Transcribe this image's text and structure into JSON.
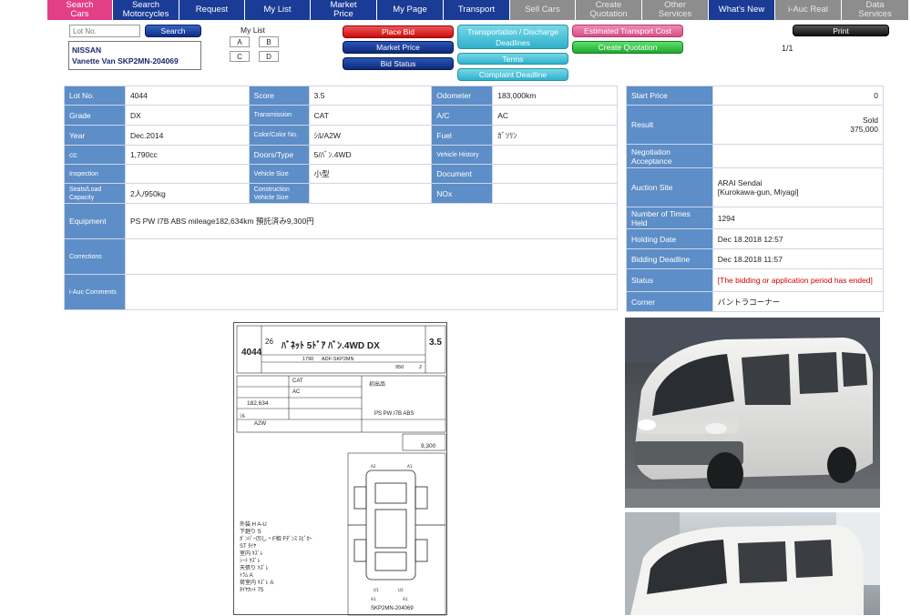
{
  "nav": [
    {
      "label": "Search\nCars",
      "style": "pink"
    },
    {
      "label": "Search\nMotorcycles",
      "style": "blue"
    },
    {
      "label": "Request",
      "style": "blue"
    },
    {
      "label": "My List",
      "style": "blue"
    },
    {
      "label": "Market\nPrice",
      "style": "blue"
    },
    {
      "label": "My Page",
      "style": "blue"
    },
    {
      "label": "Transport",
      "style": "blue"
    },
    {
      "label": "Sell Cars",
      "style": "grey"
    },
    {
      "label": "Create\nQuotation",
      "style": "grey"
    },
    {
      "label": "Other\nServices",
      "style": "grey"
    },
    {
      "label": "What's New",
      "style": "blue"
    },
    {
      "label": "i-Auc Real",
      "style": "grey"
    },
    {
      "label": "Data\nServices",
      "style": "grey"
    }
  ],
  "search": {
    "placeholder": "Lot No.",
    "button": "Search"
  },
  "car": {
    "make": "NISSAN",
    "model": "Vanette Van SKP2MN-204069"
  },
  "mylist": {
    "title": "My List",
    "slots": [
      "A",
      "B",
      "C",
      "D"
    ]
  },
  "actions": {
    "place_bid": "Place Bid",
    "market_price": "Market Price",
    "bid_status": "Bid Status",
    "transportation": "Transportation / Discharge\nDeadlines",
    "terms": "Terms",
    "complaint": "Complaint Deadline",
    "estimated_transport": "Estimated Transport Cost",
    "create_quotation": "Create Quotation",
    "print": "Print"
  },
  "pager": "1/1",
  "specs": {
    "rows": [
      [
        {
          "l": "Lot No.",
          "v": "4044"
        },
        {
          "l": "Score",
          "v": "3.5"
        },
        {
          "l": "Odometer",
          "v": "183,000km"
        }
      ],
      [
        {
          "l": "Grade",
          "v": "DX"
        },
        {
          "l": "Transmission",
          "v": "CAT"
        },
        {
          "l": "A/C",
          "v": "AC"
        }
      ],
      [
        {
          "l": "Year",
          "v": "Dec.2014"
        },
        {
          "l": "Color/Color No.",
          "v": "ｼﾙ/A2W"
        },
        {
          "l": "Fuel",
          "v": "ｶﾞｿﾘﾝ"
        }
      ],
      [
        {
          "l": "cc",
          "v": "1,790cc"
        },
        {
          "l": "Doors/Type",
          "v": "5/ﾊﾞﾝ.4WD"
        },
        {
          "l": "Vehicle History",
          "v": ""
        }
      ],
      [
        {
          "l": "Inspection",
          "v": ""
        },
        {
          "l": "Vehicle Size",
          "v": "小型"
        },
        {
          "l": "Document",
          "v": ""
        }
      ],
      [
        {
          "l": "Seats/Load\nCapacity",
          "v": "2人/950kg"
        },
        {
          "l": "Construction\nVehicle Size",
          "v": ""
        },
        {
          "l": "NOx",
          "v": ""
        }
      ]
    ],
    "equipment": {
      "l": "Equipment",
      "v": "PS PW I7B ABS mileage182,634km 預託済み9,300円"
    },
    "corrections": {
      "l": "Corrections",
      "v": ""
    },
    "comments": {
      "l": "i-Auc Comments",
      "v": ""
    }
  },
  "auction": {
    "start_price": {
      "l": "Start Price",
      "v": "0"
    },
    "result": {
      "l": "Result",
      "v1": "Sold",
      "v2": "375,000"
    },
    "negotiation": {
      "l": "Negotiation\nAcceptance",
      "v": ""
    },
    "site": {
      "l": "Auction Site",
      "v1": "ARAI Sendai",
      "v2": "[Kurokawa-gun, Miyagi]"
    },
    "times_held": {
      "l": "Number of Times\nHeld",
      "v": "1294"
    },
    "holding_date": {
      "l": "Holding Date",
      "v": "Dec 18.2018 12:57"
    },
    "bidding_deadline": {
      "l": "Bidding Deadline",
      "v": "Dec 18.2018 11:57"
    },
    "status": {
      "l": "Status",
      "v": "[The bidding or application period has ended]"
    },
    "corner": {
      "l": "Corner",
      "v": "バントラコーナー"
    }
  },
  "sheet": {
    "lot": "4044",
    "year": "26",
    "title": "ﾊﾞﾈｯﾄ 5ﾄﾞｱ ﾊﾞﾝ.4WD DX",
    "score": "3.5",
    "model_code": "ADF-SKP2MN",
    "cc": "1790",
    "load": "950",
    "seats": "2",
    "trans": "CAT",
    "ac": "AC",
    "mileage": "182,634",
    "color": "ｼﾙ",
    "color_no": "A2W",
    "equip": "PS PW I7B ABS",
    "deposit": "9,300",
    "chassis": "SKP2MN-204069",
    "first_lot": "初出品",
    "notes": [
      "外装 H A-U",
      "下廻り S",
      "ｶﾞﾝﾊﾟｰ凹し・F相 Fﾀﾞﾝｽ ｽﾋﾟｶｰ",
      "ST ﾀｲﾔ",
      "室内 ｷｽﾞﾚ",
      "ｼｰﾄ ｷｽﾞﾚ",
      "天張り ｷｽﾞﾚ",
      "ﾄﾗﾑ A",
      "荷室内 ｷｽﾞﾚ A",
      "ﾀｲﾔｶｯﾄ 75"
    ]
  }
}
